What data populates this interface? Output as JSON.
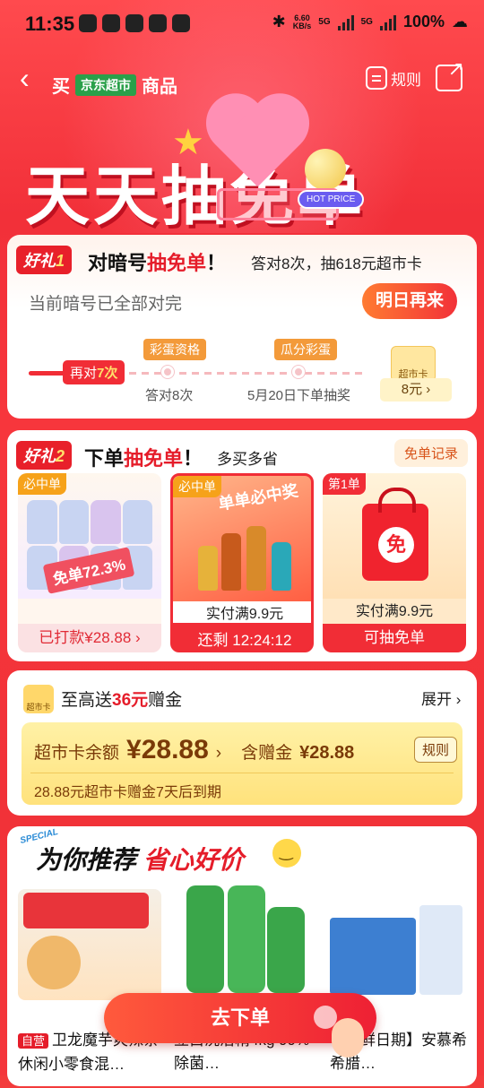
{
  "status_bar": {
    "time": "11:35",
    "net_speed_value": "6.60",
    "net_speed_unit": "KB/s",
    "signal_1": "5G",
    "signal_2": "5G",
    "battery": "100%"
  },
  "nav": {
    "prefix": "买",
    "brand": "京东超市",
    "suffix": "商品",
    "rules_label": "规则"
  },
  "hero": {
    "title": "天天抽免单",
    "hot_badge": "HOT PRICE"
  },
  "gift1": {
    "tag_prefix": "好礼",
    "tag_num": "1",
    "heading_a": "对暗号",
    "heading_hl": "抽免单",
    "heading_b": "！",
    "subtitle": "答对8次，抽618元超市卡",
    "status_text": "当前暗号已全部对完",
    "button": "明日再来",
    "progress_pill_a": "再对",
    "progress_pill_num": "7次",
    "milestone1_tag": "彩蛋资格",
    "milestone1_label": "答对8次",
    "milestone2_tag": "瓜分彩蛋",
    "milestone2_label": "5月20日下单抽奖",
    "card_icon_label": "超市卡",
    "card_value": "8元 ›"
  },
  "gift2": {
    "tag_prefix": "好礼",
    "tag_num": "2",
    "heading_a": "下单",
    "heading_hl": "抽免单",
    "heading_b": "！",
    "subtitle": "多买多省",
    "record_button": "免单记录",
    "products": [
      {
        "tag": "必中单",
        "overlay": "免单72.3%",
        "price": "",
        "bottom": "已打款¥28.88 ›"
      },
      {
        "tag": "必中单",
        "overlay": "单单必中奖",
        "price": "实付满9.9元",
        "bottom": "还剩 12:24:12"
      },
      {
        "tag": "第1单",
        "overlay": "免",
        "price": "实付满9.9元",
        "bottom": "可抽免单"
      }
    ]
  },
  "bonus": {
    "icon_label": "超市卡",
    "title_a": "至高送",
    "title_hl": "36元",
    "title_b": "赠金",
    "expand": "展开 ›",
    "balance_label": "超市卡余额",
    "balance_amount": "¥28.88",
    "balance_arrow": "›",
    "bonus_label": "含赠金",
    "bonus_amount": "¥28.88",
    "rules_button": "规则",
    "note": "28.88元超市卡赠金7天后到期"
  },
  "recommend": {
    "special": "SPECIAL",
    "title_a": "为你推荐",
    "title_hl": "省心好价",
    "items": [
      {
        "badge": "自营",
        "name": "卫龙魔芋爽辣条休闲小零食混…"
      },
      {
        "badge": "",
        "name": "立白洗洁精4kg 99%除菌…"
      },
      {
        "badge": "",
        "name": "【新鲜日期】安慕希希腊…"
      }
    ]
  },
  "cta": {
    "label": "去下单"
  },
  "colors": {
    "primary_red": "#f12d36",
    "accent_yellow": "#ffe16a",
    "brand_green": "#2aa04a"
  }
}
